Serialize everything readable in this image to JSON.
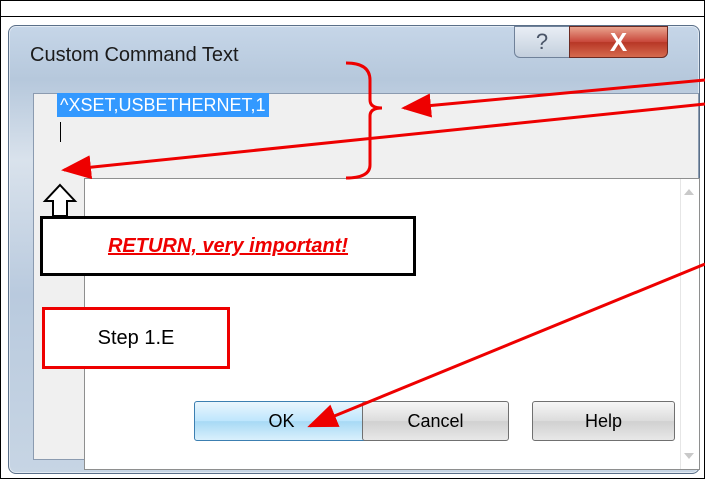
{
  "dialog": {
    "title": "Custom Command Text",
    "help_caption": "?",
    "close_caption": "X"
  },
  "editor": {
    "command_text": "^XSET,USBETHERNET,1"
  },
  "buttons": {
    "ok": "OK",
    "cancel": "Cancel",
    "help": "Help"
  },
  "annotations": {
    "return_note": "RETURN, very important!",
    "step_label": "Step 1.E",
    "accent_color": "#e00000"
  }
}
